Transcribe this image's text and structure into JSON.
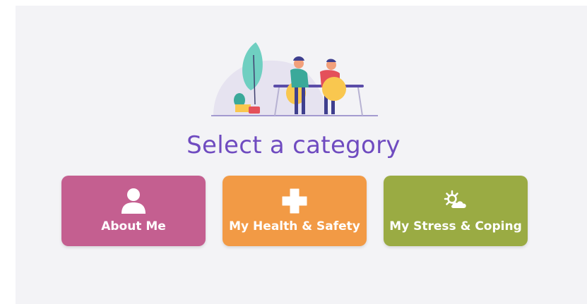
{
  "page": {
    "title": "Select a category"
  },
  "categories": [
    {
      "label": "About Me",
      "icon": "person-icon",
      "color": "#c45f90"
    },
    {
      "label": "My Health & Safety",
      "icon": "plus-icon",
      "color": "#f29a45"
    },
    {
      "label": "My Stress & Coping",
      "icon": "sun-cloud-icon",
      "color": "#9aab43"
    }
  ],
  "colors": {
    "title": "#6f4bc0",
    "background": "#f3f3f6"
  }
}
